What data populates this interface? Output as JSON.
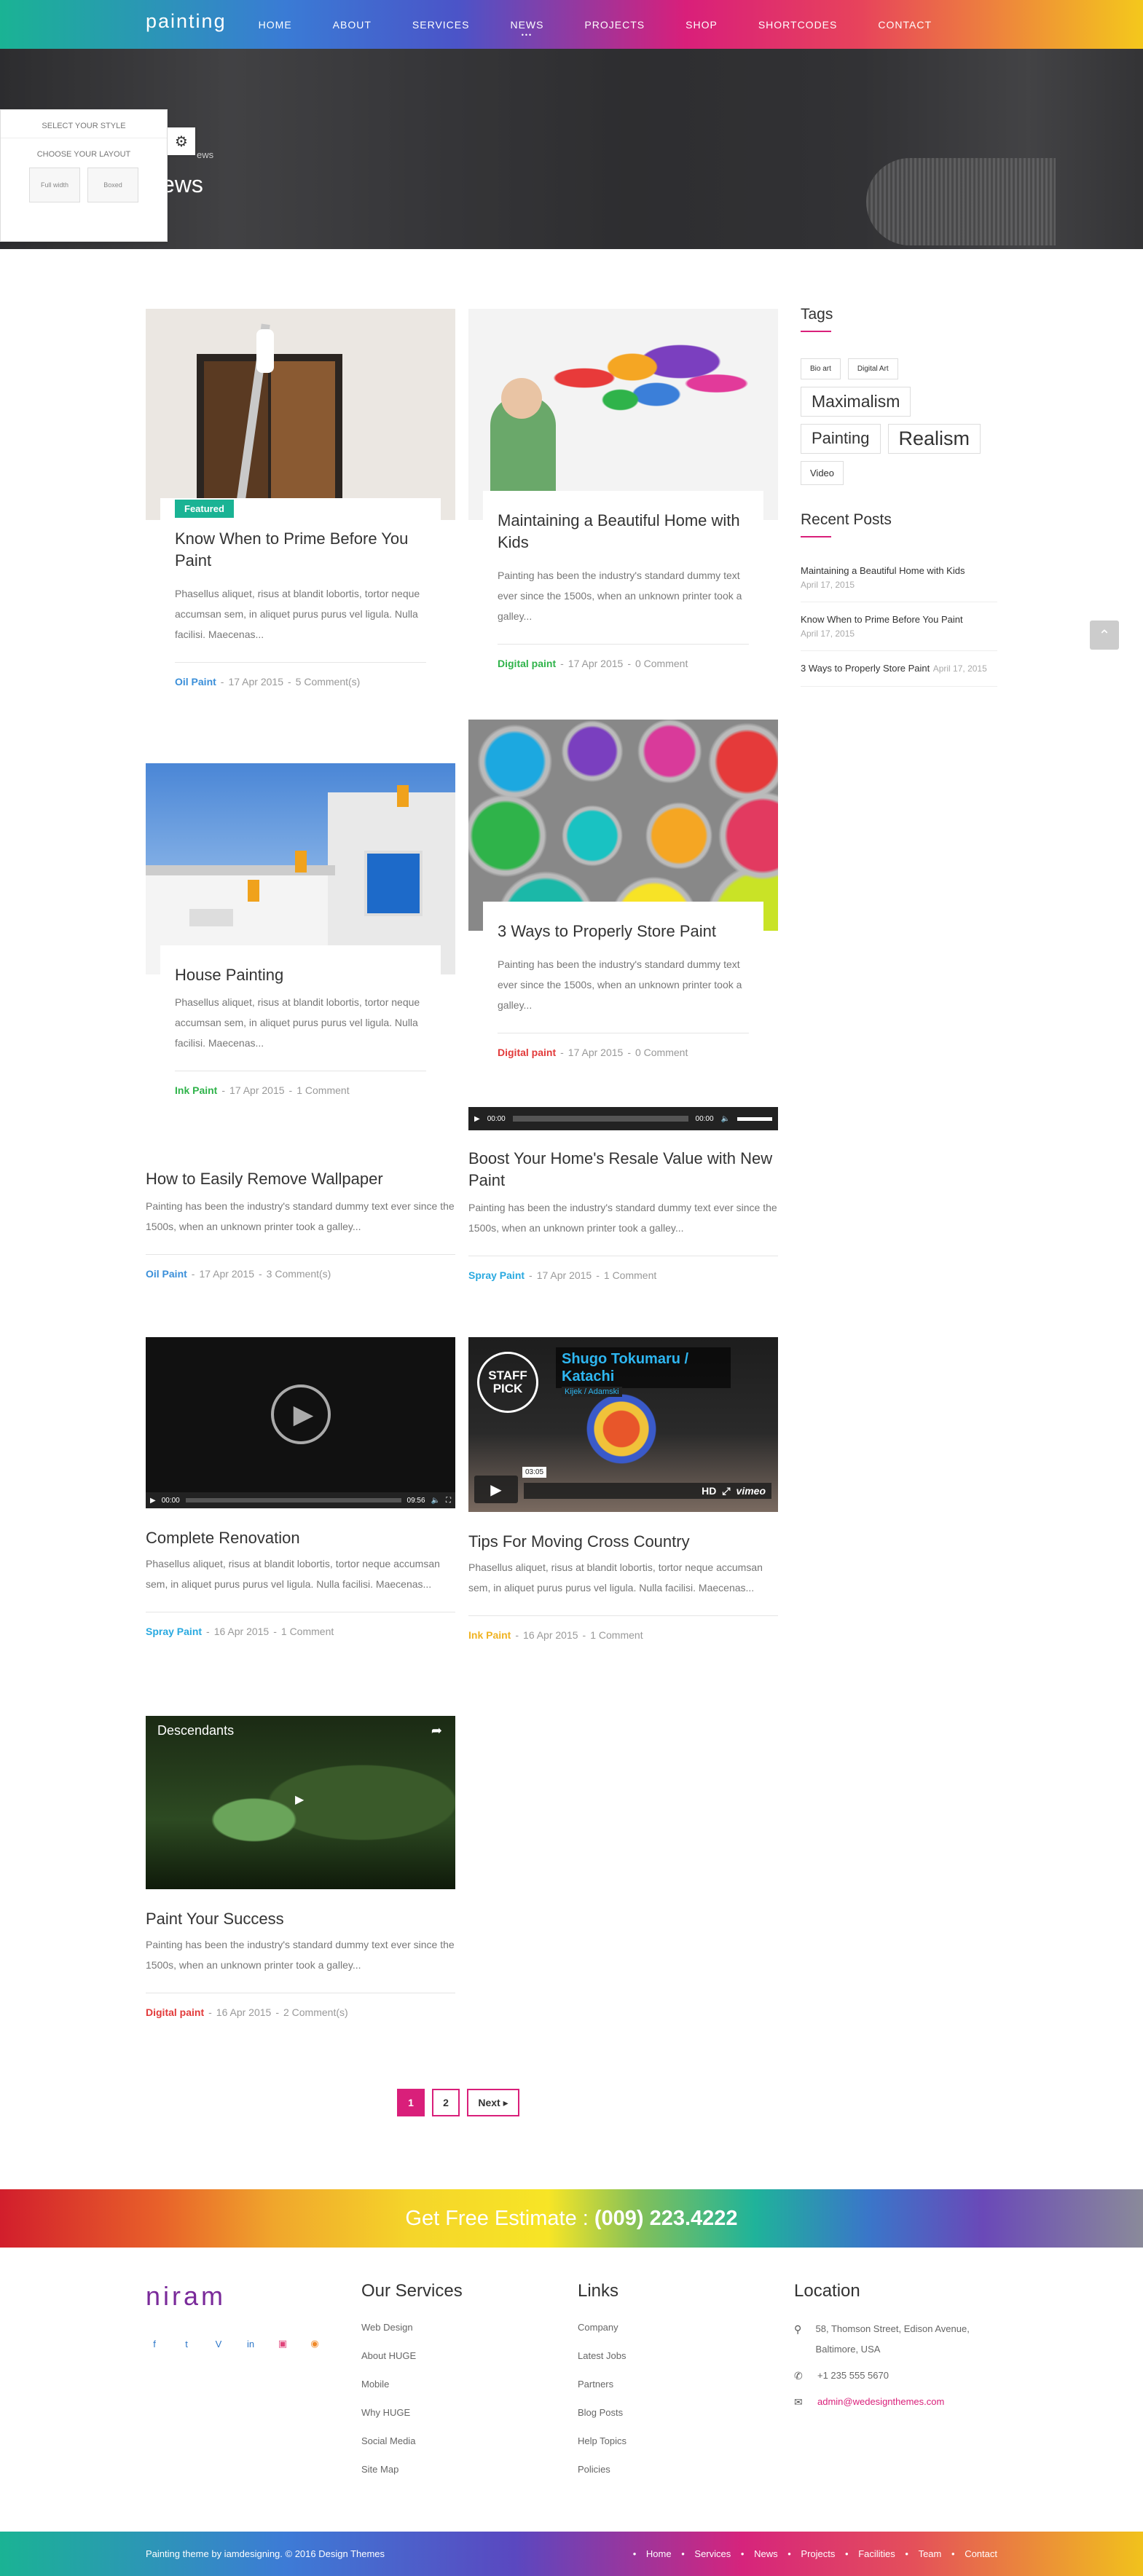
{
  "header": {
    "logo": "painting",
    "nav": [
      "HOME",
      "ABOUT",
      "SERVICES",
      "NEWS",
      "PROJECTS",
      "SHOP",
      "SHORTCODES",
      "CONTACT"
    ]
  },
  "hero": {
    "crumb": "ews",
    "title": "ews"
  },
  "style_panel": {
    "title": "SELECT YOUR STYLE",
    "layout_label": "CHOOSE YOUR LAYOUT",
    "options": [
      "Full width",
      "Boxed"
    ]
  },
  "posts": [
    {
      "badge": "Featured",
      "title": "Know When to Prime Before You Paint",
      "excerpt": "Phasellus aliquet, risus at blandit lobortis, tortor neque accumsan sem, in aliquet purus purus vel ligula. Nulla facilisi. Maecenas...",
      "category": "Oil Paint",
      "category_color": "#3b8fd9",
      "date": "17 Apr 2015",
      "comments": "5 Comment(s)"
    },
    {
      "title": "Maintaining a Beautiful Home with Kids",
      "excerpt": "Painting has been the industry's standard dummy text ever since the 1500s, when an unknown printer took a galley...",
      "category": "Digital paint",
      "category_color": "#2fb34a",
      "date": "17 Apr 2015",
      "comments": "0 Comment"
    },
    {
      "title": "House Painting",
      "excerpt": "Phasellus aliquet, risus at blandit lobortis, tortor neque accumsan sem, in aliquet purus purus vel ligula. Nulla facilisi. Maecenas...",
      "category": "Ink Paint",
      "category_color": "#2fb34a",
      "date": "17 Apr 2015",
      "comments": "1 Comment"
    },
    {
      "title": "3 Ways to Properly Store Paint",
      "excerpt": "Painting has been the industry's standard dummy text ever since the 1500s, when an unknown printer took a galley...",
      "category": "Digital paint",
      "category_color": "#e23a3a",
      "date": "17 Apr 2015",
      "comments": "0 Comment"
    },
    {
      "title": "How to Easily Remove Wallpaper",
      "excerpt": "Painting has been the industry's standard dummy text ever since the 1500s, when an unknown printer took a galley...",
      "category": "Oil Paint",
      "category_color": "#3b8fd9",
      "date": "17 Apr 2015",
      "comments": "3 Comment(s)"
    },
    {
      "title": "Boost Your Home's Resale Value with New Paint",
      "excerpt": "Painting has been the industry's standard dummy text ever since the 1500s, when an unknown printer took a galley...",
      "category": "Spray Paint",
      "category_color": "#29a9e0",
      "date": "17 Apr 2015",
      "comments": "1 Comment",
      "audio_time_start": "00:00",
      "audio_time_end": "00:00"
    },
    {
      "title": "Complete Renovation",
      "excerpt": "Phasellus aliquet, risus at blandit lobortis, tortor neque accumsan sem, in aliquet purus purus vel ligula. Nulla facilisi. Maecenas...",
      "category": "Spray Paint",
      "category_color": "#29a9e0",
      "date": "16 Apr 2015",
      "comments": "1 Comment",
      "video_time_start": "00:00",
      "video_time_end": "09:56"
    },
    {
      "title": "Tips For Moving Cross Country",
      "excerpt": "Phasellus aliquet, risus at blandit lobortis, tortor neque accumsan sem, in aliquet purus purus vel ligula. Nulla facilisi. Maecenas...",
      "category": "Ink Paint",
      "category_color": "#f0b323",
      "date": "16 Apr 2015",
      "comments": "1 Comment",
      "vimeo_title": "Shugo Tokumaru / Katachi",
      "vimeo_by": "Kijek / Adamski",
      "vimeo_time": "03:05",
      "vimeo_badge": "STAFF PICK"
    },
    {
      "title": "Paint Your Success",
      "excerpt": "Painting has been the industry's standard dummy text ever since the 1500s, when an unknown printer took a galley...",
      "category": "Digital paint",
      "category_color": "#e23a3a",
      "date": "16 Apr 2015",
      "comments": "2 Comment(s)",
      "yt_title": "Descendants"
    }
  ],
  "sidebar": {
    "tags_title": "Tags",
    "tags": [
      "Bio art",
      "Digital Art",
      "Maximalism",
      "Painting",
      "Realism",
      "Video"
    ],
    "recent_title": "Recent Posts",
    "recent": [
      {
        "title": "Maintaining a Beautiful Home with Kids",
        "date": "April 17, 2015"
      },
      {
        "title": "Know When to Prime Before You Paint",
        "date": "April 17, 2015"
      },
      {
        "title": "3 Ways to Properly Store Paint",
        "date": "April 17, 2015"
      }
    ]
  },
  "pagination": [
    "1",
    "2",
    "Next"
  ],
  "estimate": {
    "text": "Get Free Estimate :",
    "phone": "(009) 223.4222"
  },
  "footer": {
    "logo": "niram",
    "services_title": "Our Services",
    "services": [
      "Web Design",
      "About HUGE",
      "Mobile",
      "Why HUGE",
      "Social Media",
      "Site Map"
    ],
    "links_title": "Links",
    "links": [
      "Company",
      "Latest Jobs",
      "Partners",
      "Blog Posts",
      "Help Topics",
      "Policies"
    ],
    "location_title": "Location",
    "address": "58, Thomson Street, Edison Avenue, Baltimore, USA",
    "phone": "+1 235 555 5670",
    "email": "admin@wedesignthemes.com"
  },
  "bottom": {
    "copyright": "Painting theme by iamdesigning. © 2016 Design Themes",
    "links": [
      "Home",
      "Services",
      "News",
      "Projects",
      "Facilities",
      "Team",
      "Contact"
    ]
  }
}
